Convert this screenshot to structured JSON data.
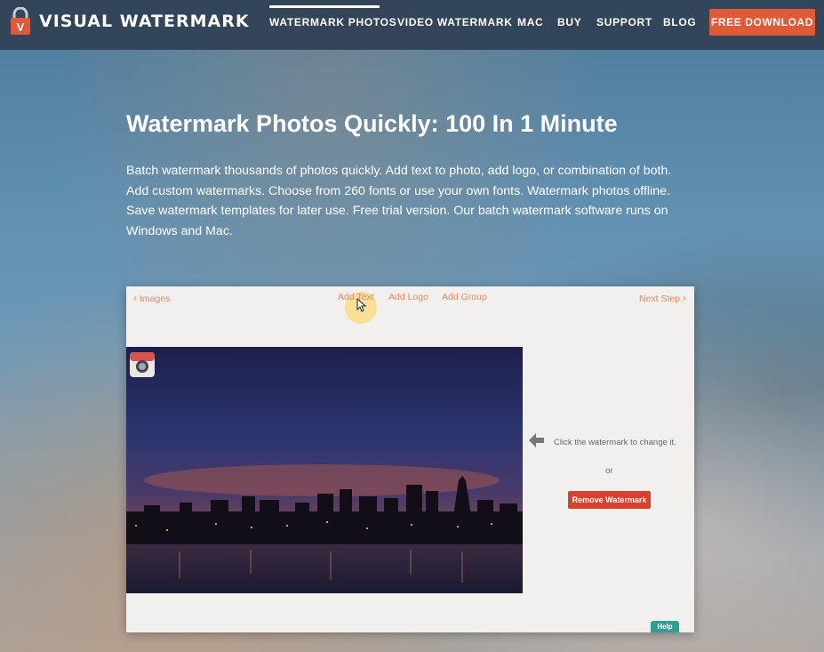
{
  "header": {
    "brand": "VISUAL WATERMARK",
    "nav": [
      {
        "label": "WATERMARK PHOTOS",
        "active": true
      },
      {
        "label": "VIDEO WATERMARK"
      },
      {
        "label": "MAC"
      },
      {
        "label": "BUY"
      },
      {
        "label": "SUPPORT"
      },
      {
        "label": "BLOG"
      }
    ],
    "cta_label": "FREE DOWNLOAD",
    "logo_letter": "V"
  },
  "hero": {
    "title": "Watermark Photos Quickly: 100 In 1 Minute",
    "description": "Batch watermark thousands of photos quickly. Add text to photo, add logo, or combination of both. Add custom watermarks. Choose from 260 fonts or use your own fonts. Watermark photos offline. Save watermark templates for later use. Free trial version. Our batch watermark software runs on Windows and Mac."
  },
  "app": {
    "back_label": "Images",
    "add_text": "Add Text",
    "add_logo": "Add Logo",
    "add_group": "Add Group",
    "next_label": "Next Step",
    "hint": "Click the watermark to change it.",
    "or": "or",
    "remove_label": "Remove Watermark",
    "help_label": "Help"
  },
  "colors": {
    "header_bg": "#304054",
    "accent": "#e05a38",
    "link": "#e8895f",
    "remove": "#d8412e",
    "help": "#2f9f8f"
  }
}
